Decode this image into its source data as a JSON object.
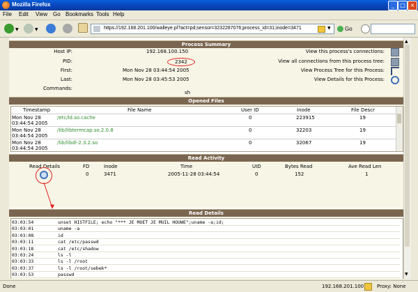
{
  "window": {
    "title": "Mozilla Firefox",
    "minimize": "_",
    "maximize": "□",
    "close": "×"
  },
  "menu": [
    "File",
    "Edit",
    "View",
    "Go",
    "Bookmarks",
    "Tools",
    "Help"
  ],
  "toolbar": {
    "url": "https://192.168.201.100/walleye.pl?act=pd;sensor=3232287076;process_id=31;inode=3471",
    "go_label": "Go"
  },
  "process_summary": {
    "header": "Process Summary",
    "host_ip_label": "Host IP:",
    "host_ip": "192.168.100.150",
    "pid_label": "PID:",
    "pid": "2342",
    "first_label": "First:",
    "first": "Mon Nov 28 03:44:54 2005",
    "last_label": "Last:",
    "last": "Mon Nov 28 03:45:53 2005",
    "commands_label": "Commands:",
    "commands": "sh",
    "links": [
      "View this process's connections:",
      "View all connections from this process tree:",
      "View Process Tree for this Process:",
      "View Details for this Process:"
    ]
  },
  "opened_files": {
    "header": "Opened Files",
    "columns": [
      "Timestamp",
      "File Name",
      "User ID",
      "Inode",
      "File Descr"
    ],
    "rows": [
      {
        "ts1": "Mon Nov 28",
        "ts2": "03:44:54 2005",
        "file": "/etc/ld.so.cache",
        "uid": "0",
        "inode": "223915",
        "fd": "19"
      },
      {
        "ts1": "Mon Nov 28",
        "ts2": "03:44:54 2005",
        "file": "/lib/libtermcap.so.2.0.8",
        "uid": "0",
        "inode": "32203",
        "fd": "19"
      },
      {
        "ts1": "Mon Nov 28",
        "ts2": "03:44:54 2005",
        "file": "/lib/libdl-2.3.2.so",
        "uid": "0",
        "inode": "32067",
        "fd": "19"
      }
    ]
  },
  "read_activity": {
    "header": "Read Activity",
    "columns": [
      "Read Details",
      "FD",
      "Inode",
      "Time",
      "UID",
      "Bytes Read",
      "Ave Read Len"
    ],
    "row": {
      "fd": "0",
      "inode": "3471",
      "time": "2005-11-28 03:44:54",
      "uid": "0",
      "bytes": "152",
      "ave": "1"
    }
  },
  "read_details": {
    "header": "Read Details",
    "rows": [
      {
        "time": "03:03:54",
        "cmd": "unset HISTFILE; echo \"*** JE MOET JE MUIL HOUWE\";uname -a;id;"
      },
      {
        "time": "03:03:01",
        "cmd": "uname -a"
      },
      {
        "time": "03:03:08",
        "cmd": "id"
      },
      {
        "time": "03:03:11",
        "cmd": "cat /etc/passwd"
      },
      {
        "time": "03:03:18",
        "cmd": "cat /etc/shadow"
      },
      {
        "time": "03:03:24",
        "cmd": "ls -l"
      },
      {
        "time": "03:03:33",
        "cmd": "ls -l /root"
      },
      {
        "time": "03:03:37",
        "cmd": "ls -l /root/sebek*"
      },
      {
        "time": "03:03:53",
        "cmd": "passwd"
      }
    ]
  },
  "status": {
    "left": "Done",
    "ip": "192.168.201.100",
    "proxy": "Proxy: None"
  }
}
